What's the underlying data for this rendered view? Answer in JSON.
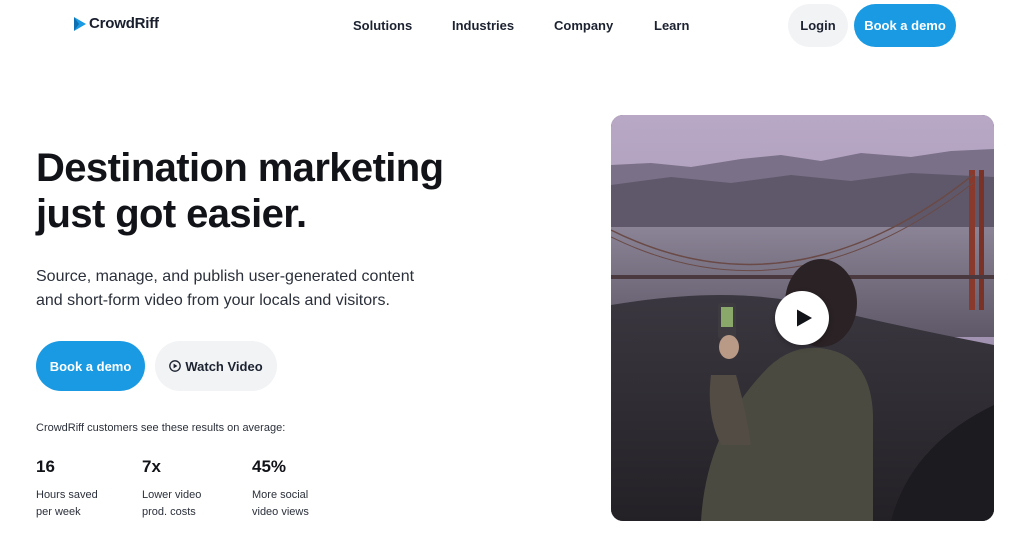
{
  "header": {
    "brand": "CrowdRiff",
    "nav": [
      {
        "label": "Solutions"
      },
      {
        "label": "Industries"
      },
      {
        "label": "Company"
      },
      {
        "label": "Learn"
      }
    ],
    "login_label": "Login",
    "demo_label": "Book a demo"
  },
  "hero": {
    "title_line1": "Destination marketing",
    "title_line2": "just got easier.",
    "subtitle_line1": "Source, manage, and publish user-generated content",
    "subtitle_line2": "and short-form video from your locals and visitors.",
    "primary_button": "Book a demo",
    "secondary_button": "Watch Video"
  },
  "stats": {
    "caption": "CrowdRiff customers see these results on average:",
    "items": [
      {
        "value": "16",
        "label_line1": "Hours saved",
        "label_line2": "per week"
      },
      {
        "value": "7x",
        "label_line1": "Lower video",
        "label_line2": "prod. costs"
      },
      {
        "value": "45%",
        "label_line1": "More social",
        "label_line2": "video views"
      }
    ]
  },
  "video": {
    "icon": "play-icon"
  },
  "colors": {
    "accent": "#1a9ae3",
    "secondary_bg": "#f1f3f5",
    "text": "#111318"
  }
}
